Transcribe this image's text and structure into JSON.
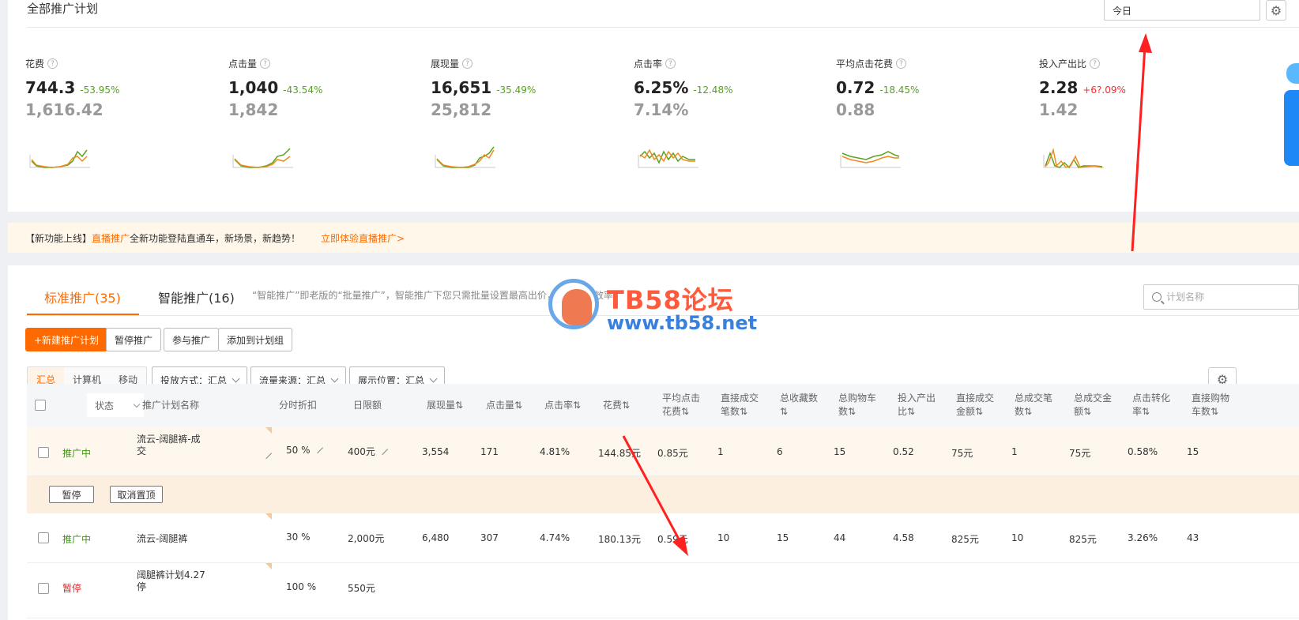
{
  "header": {
    "title": "全部推广计划",
    "date_value": "今日"
  },
  "metrics": [
    {
      "label": "花费",
      "value": "744.3",
      "change": "-53.95%",
      "trend": "down",
      "previous": "1,616.42"
    },
    {
      "label": "点击量",
      "value": "1,040",
      "change": "-43.54%",
      "trend": "down",
      "previous": "1,842"
    },
    {
      "label": "展现量",
      "value": "16,651",
      "change": "-35.49%",
      "trend": "down",
      "previous": "25,812"
    },
    {
      "label": "点击率",
      "value": "6.25%",
      "change": "-12.48%",
      "trend": "down",
      "previous": "7.14%"
    },
    {
      "label": "平均点击花费",
      "value": "0.72",
      "change": "-18.45%",
      "trend": "down",
      "previous": "0.88"
    },
    {
      "label": "投入产出比",
      "value": "2.28",
      "change": "+6?.09%",
      "trend": "up",
      "previous": "1.42"
    }
  ],
  "notice": {
    "prefix": "【新功能上线】",
    "highlight": "直播推广",
    "text": "全新功能登陆直通车，新场景，新趋势！",
    "cta": "立即体验直播推广>"
  },
  "tabs": [
    {
      "label": "标准推广(35)",
      "active": true
    },
    {
      "label": "智能推广(16)",
      "active": false
    }
  ],
  "tab_hint": "“智能推广”即老版的“批量推广”，智能推广下您只需批量设置最高出价，提升推广效率",
  "search": {
    "placeholder": "计划名称"
  },
  "toolbar": {
    "new_plan": "+新建推广计划",
    "pause": "暂停推广",
    "join": "参与推广",
    "add_group": "添加到计划组"
  },
  "segments": [
    "汇总",
    "计算机",
    "移动"
  ],
  "filters": [
    {
      "label": "投放方式：汇总"
    },
    {
      "label": "流量来源：汇总"
    },
    {
      "label": "展示位置：汇总"
    }
  ],
  "table": {
    "status_filter": "状态",
    "headers": {
      "name": "推广计划名称",
      "time_discount": "分时折扣",
      "daily_limit": "日限额",
      "impressions": "展现量⇅",
      "clicks": "点击量⇅",
      "ctr": "点击率⇅",
      "cost": "花费⇅",
      "avg_cpc_1": "平均点击",
      "avg_cpc_2": "花费⇅",
      "direct_orders_1": "直接成交",
      "direct_orders_2": "笔数⇅",
      "total_fav_1": "总收藏数",
      "total_fav_2": "⇅",
      "total_cart_1": "总购物车",
      "total_cart_2": "数⇅",
      "roi_1": "投入产出",
      "roi_2": "比⇅",
      "direct_amount_1": "直接成交",
      "direct_amount_2": "金额⇅",
      "total_orders_1": "总成交笔",
      "total_orders_2": "数⇅",
      "total_amount_1": "总成交金",
      "total_amount_2": "额⇅",
      "cvr_1": "点击转化",
      "cvr_2": "率⇅",
      "direct_cart_1": "直接购物",
      "direct_cart_2": "车数⇅"
    },
    "rows": [
      {
        "status": "推广中",
        "name_1": "流云-阔腿裤-成",
        "name_2": "交",
        "time_discount": "50 %",
        "daily_limit": "400元",
        "impressions": "3,554",
        "clicks": "171",
        "ctr": "4.81%",
        "cost": "144.85元",
        "avg_cpc": "0.85元",
        "direct_orders": "1",
        "total_fav": "6",
        "total_cart": "15",
        "roi": "0.52",
        "direct_amount": "75元",
        "total_orders": "1",
        "total_amount": "75元",
        "cvr": "0.58%",
        "direct_cart": "15"
      },
      {
        "status": "推广中",
        "name_1": "流云-阔腿裤",
        "name_2": "",
        "time_discount": "30 %",
        "daily_limit": "2,000元",
        "impressions": "6,480",
        "clicks": "307",
        "ctr": "4.74%",
        "cost": "180.13元",
        "avg_cpc": "0.59元",
        "direct_orders": "10",
        "total_fav": "15",
        "total_cart": "44",
        "roi": "4.58",
        "direct_amount": "825元",
        "total_orders": "10",
        "total_amount": "825元",
        "cvr": "3.26%",
        "direct_cart": "43"
      },
      {
        "status": "暂停",
        "name_1": "阔腿裤计划4.27",
        "name_2": "停",
        "time_discount": "100 %",
        "daily_limit": "550元"
      }
    ],
    "row_actions": {
      "pause": "暂停",
      "unpin": "取消置顶"
    }
  },
  "watermark": {
    "title": "TB58论坛",
    "url": "www.tb58.net"
  },
  "colors": {
    "accent": "#ff6a00",
    "down": "#52a31c",
    "up": "#ff2a2a",
    "active_status": "#3c9a12",
    "paused_status": "#e0262c",
    "annotation_arrow": "#ff2020"
  }
}
